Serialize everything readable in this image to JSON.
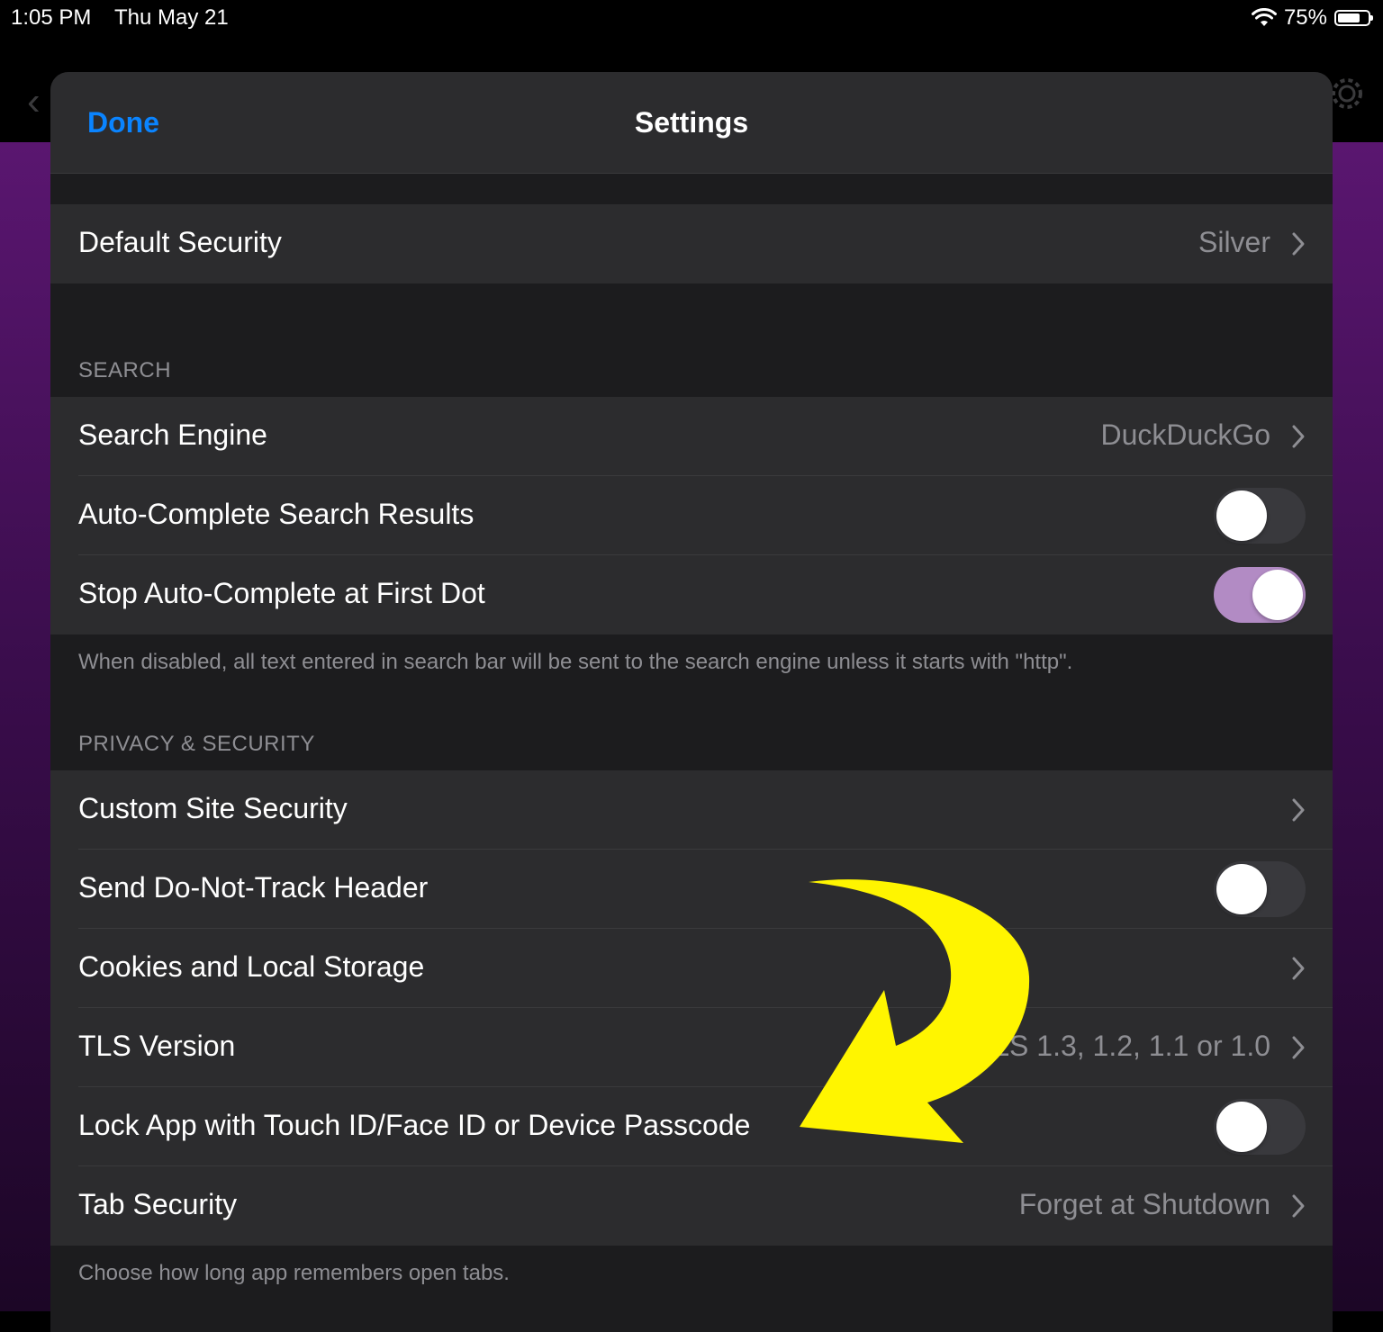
{
  "status_bar": {
    "time": "1:05 PM",
    "date": "Thu May 21",
    "battery": "75%",
    "battery_level": 0.75,
    "wifi_icon": "wifi-icon",
    "battery_icon": "battery-icon"
  },
  "nav": {
    "done_label": "Done",
    "title": "Settings"
  },
  "default_security": {
    "label": "Default Security",
    "value": "Silver"
  },
  "search_section": {
    "header": "SEARCH",
    "search_engine": {
      "label": "Search Engine",
      "value": "DuckDuckGo"
    },
    "auto_complete": {
      "label": "Auto-Complete Search Results",
      "on": false
    },
    "stop_auto_complete": {
      "label": "Stop Auto-Complete at First Dot",
      "on": true
    },
    "footer": "When disabled, all text entered in search bar will be sent to the search engine unless it starts with \"http\"."
  },
  "privacy_section": {
    "header": "PRIVACY & SECURITY",
    "custom_site_security": {
      "label": "Custom Site Security"
    },
    "do_not_track": {
      "label": "Send Do-Not-Track Header",
      "on": false
    },
    "cookies": {
      "label": "Cookies and Local Storage"
    },
    "tls_version": {
      "label": "TLS Version",
      "value": "TLS 1.3, 1.2, 1.1 or 1.0"
    },
    "lock_app": {
      "label": "Lock App with Touch ID/Face ID or Device Passcode",
      "on": false
    },
    "tab_security": {
      "label": "Tab Security",
      "value": "Forget at Shutdown"
    },
    "footer": "Choose how long app remembers open tabs."
  },
  "colors": {
    "accent": "#0a84ff",
    "toggle_on": "#b28bc4",
    "annotation_arrow": "#fff500"
  }
}
